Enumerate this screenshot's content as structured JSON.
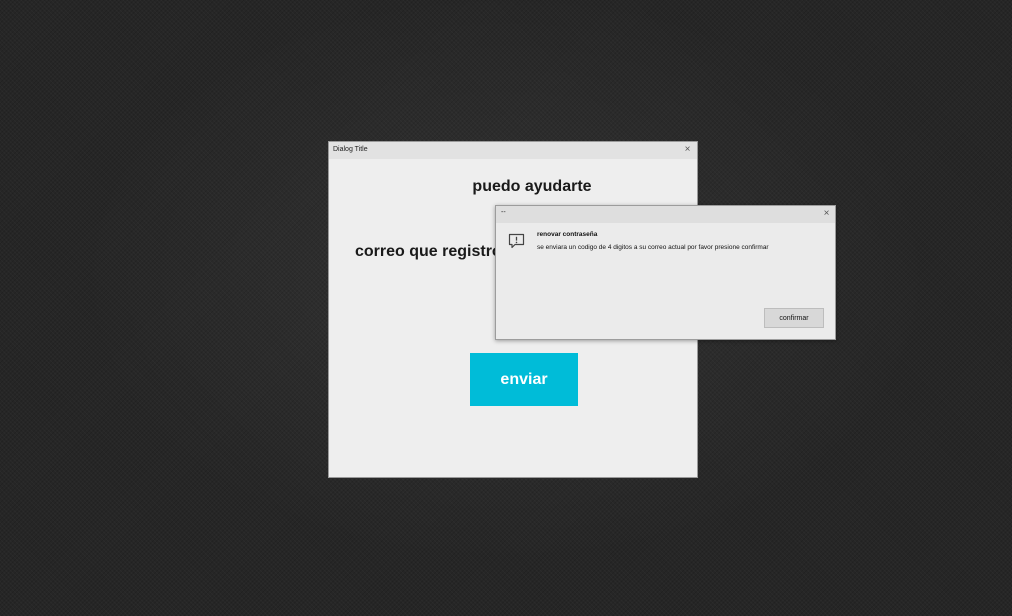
{
  "main_dialog": {
    "title": "Dialog Title",
    "close_glyph": "×",
    "heading": "puedo ayudarte",
    "email_label": "correo que registro",
    "send_button": "enviar",
    "accent_color": "#00bcd8"
  },
  "message_box": {
    "title": "--",
    "close_glyph": "×",
    "icon": "comment-alert-icon",
    "heading": "renovar contraseña",
    "body": "se enviara un codigo de 4 digitos a su correo actual por favor presione confirmar",
    "confirm_button": "confirmar"
  }
}
